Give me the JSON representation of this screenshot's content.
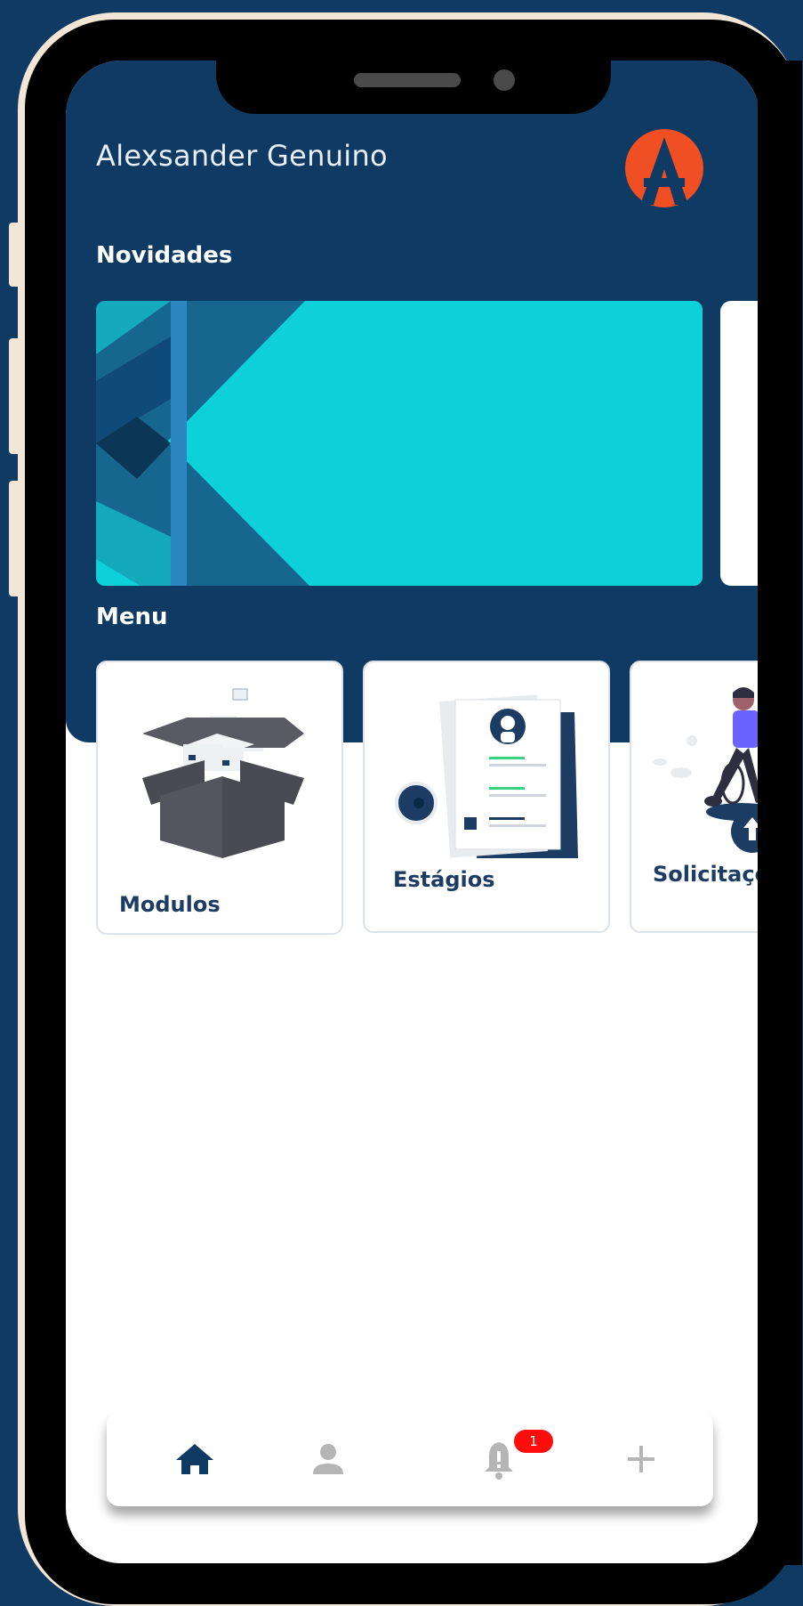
{
  "user": {
    "name": "Alexsander Genuino"
  },
  "sections": {
    "news_title": "Novidades",
    "menu_title": "Menu"
  },
  "menu": {
    "items": [
      {
        "label": "Modulos"
      },
      {
        "label": "Estágios"
      },
      {
        "label": "Solicitações"
      }
    ]
  },
  "bottom_nav": {
    "items": [
      {
        "icon": "home-icon",
        "active": true
      },
      {
        "icon": "profile-icon",
        "active": false
      },
      {
        "icon": "bell-icon",
        "active": false
      },
      {
        "icon": "plus-icon",
        "active": false
      }
    ],
    "notification_count": "1"
  },
  "colors": {
    "primary": "#0f3a63",
    "banner": "#0dd0d8",
    "logo": "#f04e23",
    "badge": "#ff0d0d"
  }
}
